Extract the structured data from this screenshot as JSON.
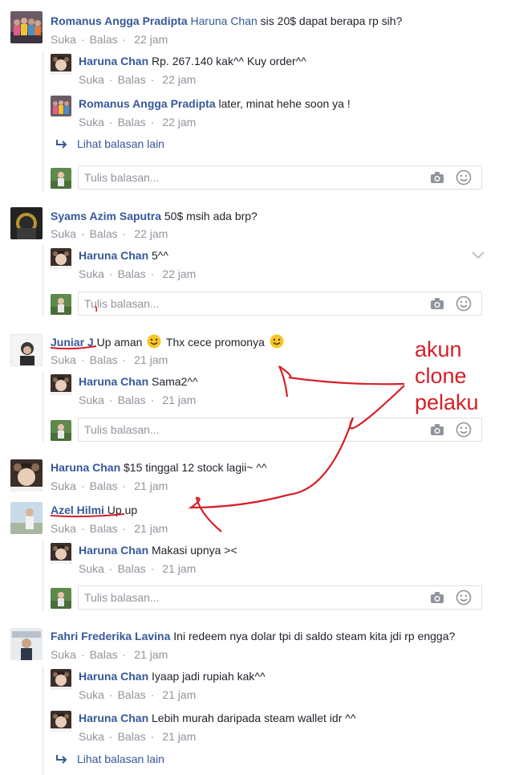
{
  "actions": {
    "like": "Suka",
    "reply": "Balas",
    "sep": "·"
  },
  "reply_placeholder": "Tulis balasan...",
  "more_replies": "Lihat balasan lain",
  "annotation": {
    "line1": "akun",
    "line2": "clone",
    "line3": "pelaku"
  },
  "threads": [
    {
      "comment": {
        "name": "Romanus Angga Pradipta",
        "tag": "Haruna Chan",
        "text": " sis 20$ dapat berapa rp sih?",
        "time": "22 jam"
      },
      "replies": [
        {
          "name": "Haruna Chan",
          "text": " Rp. 267.140 kak^^ Kuy order^^",
          "time": "22 jam"
        },
        {
          "name": "Romanus Angga Pradipta",
          "text": " later, minat hehe soon ya !",
          "time": "22 jam"
        }
      ]
    },
    {
      "comment": {
        "name": "Syams Azim Saputra",
        "text": " 50$ msih ada brp?",
        "time": "22 jam"
      },
      "replies": [
        {
          "name": "Haruna Chan",
          "text": " 5^^",
          "time": "22 jam"
        }
      ]
    },
    {
      "comment": {
        "name": "Juniar J",
        "text_a": " Up aman ",
        "text_b": " Thx cece promonya ",
        "time": "21 jam"
      },
      "replies": [
        {
          "name": "Haruna Chan",
          "text": " Sama2^^",
          "time": "21 jam"
        }
      ]
    },
    {
      "comment": {
        "name": "Haruna Chan",
        "text": " $15 tinggal 12 stock lagii~ ^^",
        "time": "21 jam"
      },
      "comment2": {
        "name": "Azel Hilmi",
        "text": " Up up",
        "time": "21 jam"
      },
      "replies": [
        {
          "name": "Haruna Chan",
          "text": " Makasi upnya ><",
          "time": "21 jam"
        }
      ]
    },
    {
      "comment": {
        "name": "Fahri Frederika Lavina",
        "text": " Ini redeem nya dolar tpi di saldo steam kita jdi rp engga?",
        "time": "21 jam"
      },
      "replies": [
        {
          "name": "Haruna Chan",
          "text": " Iyaap jadi rupiah kak^^",
          "time": "21 jam"
        },
        {
          "name": "Haruna Chan",
          "text": " Lebih murah daripada steam wallet idr ^^",
          "time": "21 jam"
        }
      ]
    }
  ]
}
